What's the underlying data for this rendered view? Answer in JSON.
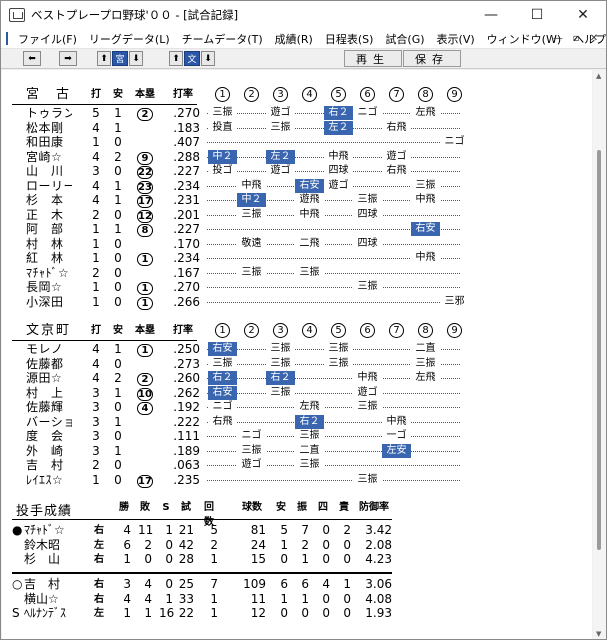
{
  "window": {
    "title": "ベストプレープロ野球'００ - [試合記録]",
    "min": "—",
    "max": "☐",
    "close": "✕"
  },
  "menu": [
    "ファイル(F)",
    "リーグデータ(L)",
    "チームデータ(T)",
    "成績(R)",
    "日程表(S)",
    "試合(G)",
    "表示(V)",
    "ウィンドウ(W)",
    "ヘルプ(H)"
  ],
  "mdi": [
    "—",
    "▫",
    "✕"
  ],
  "toolbar": {
    "left": "⬅",
    "right": "➡",
    "up1": "⬆",
    "team1": "宮",
    "dn1": "⬇",
    "up2": "⬆",
    "team2": "文",
    "dn2": "⬇",
    "play": "再生",
    "save": "保存"
  },
  "headers": {
    "at_bat": "打",
    "hit": "安",
    "hr": "本塁",
    "avg": "打率",
    "innings": [
      "1",
      "2",
      "3",
      "4",
      "5",
      "6",
      "7",
      "8",
      "9"
    ]
  },
  "team1": {
    "name": "宮　古",
    "players": [
      {
        "name": "トゥラング",
        "ab": "5",
        "h": "1",
        "hr": "2",
        "avg": ".270",
        "cells": [
          [
            "三振",
            0
          ],
          [
            "",
            0
          ],
          [
            "遊ゴ",
            0
          ],
          [
            "",
            0
          ],
          [
            "右２",
            1
          ],
          [
            "ニゴ",
            0
          ],
          [
            "",
            0
          ],
          [
            "左飛",
            0
          ],
          [
            "",
            0
          ]
        ]
      },
      {
        "name": "松本剛",
        "ab": "4",
        "h": "1",
        "hr": "",
        "avg": ".183",
        "cells": [
          [
            "投直",
            0
          ],
          [
            "",
            0
          ],
          [
            "三振",
            0
          ],
          [
            "",
            0
          ],
          [
            "左２",
            1
          ],
          [
            "",
            0
          ],
          [
            "右飛",
            0
          ],
          [
            "",
            0
          ],
          [
            "",
            0
          ]
        ]
      },
      {
        "name": "和田康",
        "ab": "1",
        "h": "0",
        "hr": "",
        "avg": ".407",
        "cells": [
          [
            "",
            0
          ],
          [
            "",
            0
          ],
          [
            "",
            0
          ],
          [
            "",
            0
          ],
          [
            "",
            0
          ],
          [
            "",
            0
          ],
          [
            "",
            0
          ],
          [
            "",
            0
          ],
          [
            "ニゴ",
            0
          ]
        ]
      },
      {
        "name": "宮崎☆",
        "ab": "4",
        "h": "2",
        "hr": "9",
        "avg": ".288",
        "cells": [
          [
            "中２",
            1
          ],
          [
            "",
            0
          ],
          [
            "左２",
            1
          ],
          [
            "",
            0
          ],
          [
            "中飛",
            0
          ],
          [
            "",
            0
          ],
          [
            "遊ゴ",
            0
          ],
          [
            "",
            0
          ],
          [
            "",
            0
          ]
        ]
      },
      {
        "name": "山　川",
        "ab": "3",
        "h": "0",
        "hr": "22",
        "avg": ".227",
        "cells": [
          [
            "投ゴ",
            0
          ],
          [
            "",
            0
          ],
          [
            "遊ゴ",
            0
          ],
          [
            "",
            0
          ],
          [
            "四球",
            0
          ],
          [
            "",
            0
          ],
          [
            "右飛",
            0
          ],
          [
            "",
            0
          ],
          [
            "",
            0
          ]
        ]
      },
      {
        "name": "ローリー",
        "ab": "4",
        "h": "1",
        "hr": "23",
        "avg": ".234",
        "cells": [
          [
            "",
            0
          ],
          [
            "中飛",
            0
          ],
          [
            "",
            0
          ],
          [
            "右安",
            1
          ],
          [
            "遊ゴ",
            0
          ],
          [
            "",
            0
          ],
          [
            "",
            0
          ],
          [
            "三振",
            0
          ],
          [
            "",
            0
          ]
        ]
      },
      {
        "name": "杉　本",
        "ab": "4",
        "h": "1",
        "hr": "17",
        "avg": ".231",
        "cells": [
          [
            "",
            0
          ],
          [
            "中２",
            1
          ],
          [
            "",
            0
          ],
          [
            "遊飛",
            0
          ],
          [
            "",
            0
          ],
          [
            "三振",
            0
          ],
          [
            "",
            0
          ],
          [
            "中飛",
            0
          ],
          [
            "",
            0
          ]
        ]
      },
      {
        "name": "正　木",
        "ab": "2",
        "h": "0",
        "hr": "12",
        "avg": ".201",
        "cells": [
          [
            "",
            0
          ],
          [
            "三振",
            0
          ],
          [
            "",
            0
          ],
          [
            "中飛",
            0
          ],
          [
            "",
            0
          ],
          [
            "四球",
            0
          ],
          [
            "",
            0
          ],
          [
            "",
            0
          ],
          [
            "",
            0
          ]
        ]
      },
      {
        "name": "阿　部",
        "ab": "1",
        "h": "1",
        "hr": "8",
        "avg": ".227",
        "cells": [
          [
            "",
            0
          ],
          [
            "",
            0
          ],
          [
            "",
            0
          ],
          [
            "",
            0
          ],
          [
            "",
            0
          ],
          [
            "",
            0
          ],
          [
            "",
            0
          ],
          [
            "右安",
            1
          ],
          [
            "",
            0
          ]
        ]
      },
      {
        "name": "村　林",
        "ab": "1",
        "h": "0",
        "hr": "",
        "avg": ".170",
        "cells": [
          [
            "",
            0
          ],
          [
            "敬遠",
            0
          ],
          [
            "",
            0
          ],
          [
            "二飛",
            0
          ],
          [
            "",
            0
          ],
          [
            "四球",
            0
          ],
          [
            "",
            0
          ],
          [
            "",
            0
          ],
          [
            "",
            0
          ]
        ]
      },
      {
        "name": "紅　林",
        "ab": "1",
        "h": "0",
        "hr": "1",
        "avg": ".234",
        "cells": [
          [
            "",
            0
          ],
          [
            "",
            0
          ],
          [
            "",
            0
          ],
          [
            "",
            0
          ],
          [
            "",
            0
          ],
          [
            "",
            0
          ],
          [
            "",
            0
          ],
          [
            "中飛",
            0
          ],
          [
            "",
            0
          ]
        ]
      },
      {
        "name": "ﾏﾁｬﾄﾞ☆",
        "ab": "2",
        "h": "0",
        "hr": "",
        "avg": ".167",
        "cells": [
          [
            "",
            0
          ],
          [
            "三振",
            0
          ],
          [
            "",
            0
          ],
          [
            "三振",
            0
          ],
          [
            "",
            0
          ],
          [
            "",
            0
          ],
          [
            "",
            0
          ],
          [
            "",
            0
          ],
          [
            "",
            0
          ]
        ]
      },
      {
        "name": "長岡☆",
        "ab": "1",
        "h": "0",
        "hr": "1",
        "avg": ".270",
        "cells": [
          [
            "",
            0
          ],
          [
            "",
            0
          ],
          [
            "",
            0
          ],
          [
            "",
            0
          ],
          [
            "",
            0
          ],
          [
            "三振",
            0
          ],
          [
            "",
            0
          ],
          [
            "",
            0
          ],
          [
            "",
            0
          ]
        ]
      },
      {
        "name": "小深田",
        "ab": "1",
        "h": "0",
        "hr": "1",
        "avg": ".266",
        "cells": [
          [
            "",
            0
          ],
          [
            "",
            0
          ],
          [
            "",
            0
          ],
          [
            "",
            0
          ],
          [
            "",
            0
          ],
          [
            "",
            0
          ],
          [
            "",
            0
          ],
          [
            "",
            0
          ],
          [
            "三邪",
            0
          ]
        ]
      }
    ]
  },
  "team2": {
    "name": "文京町",
    "players": [
      {
        "name": "モレノ",
        "ab": "4",
        "h": "1",
        "hr": "1",
        "avg": ".250",
        "cells": [
          [
            "右安",
            1
          ],
          [
            "",
            0
          ],
          [
            "三振",
            0
          ],
          [
            "",
            0
          ],
          [
            "三振",
            0
          ],
          [
            "",
            0
          ],
          [
            "",
            0
          ],
          [
            "二直",
            0
          ],
          [
            "",
            0
          ]
        ]
      },
      {
        "name": "佐藤都",
        "ab": "4",
        "h": "0",
        "hr": "",
        "avg": ".273",
        "cells": [
          [
            "三振",
            0
          ],
          [
            "",
            0
          ],
          [
            "三振",
            0
          ],
          [
            "",
            0
          ],
          [
            "三振",
            0
          ],
          [
            "",
            0
          ],
          [
            "",
            0
          ],
          [
            "三振",
            0
          ],
          [
            "",
            0
          ]
        ]
      },
      {
        "name": "源田☆",
        "ab": "4",
        "h": "2",
        "hr": "2",
        "avg": ".260",
        "cells": [
          [
            "右２",
            1
          ],
          [
            "",
            0
          ],
          [
            "右２",
            1
          ],
          [
            "",
            0
          ],
          [
            "",
            0
          ],
          [
            "中飛",
            0
          ],
          [
            "",
            0
          ],
          [
            "左飛",
            0
          ],
          [
            "",
            0
          ]
        ]
      },
      {
        "name": "村　上",
        "ab": "3",
        "h": "1",
        "hr": "10",
        "avg": ".262",
        "cells": [
          [
            "右安",
            1
          ],
          [
            "",
            0
          ],
          [
            "三振",
            0
          ],
          [
            "",
            0
          ],
          [
            "",
            0
          ],
          [
            "遊ゴ",
            0
          ],
          [
            "",
            0
          ],
          [
            "",
            0
          ],
          [
            "",
            0
          ]
        ]
      },
      {
        "name": "佐藤輝",
        "ab": "3",
        "h": "0",
        "hr": "4",
        "avg": ".192",
        "cells": [
          [
            "ニゴ",
            0
          ],
          [
            "",
            0
          ],
          [
            "",
            0
          ],
          [
            "左飛",
            0
          ],
          [
            "",
            0
          ],
          [
            "三振",
            0
          ],
          [
            "",
            0
          ],
          [
            "",
            0
          ],
          [
            "",
            0
          ]
        ]
      },
      {
        "name": "バーショ",
        "ab": "3",
        "h": "1",
        "hr": "",
        "avg": ".222",
        "cells": [
          [
            "右飛",
            0
          ],
          [
            "",
            0
          ],
          [
            "",
            0
          ],
          [
            "右２",
            1
          ],
          [
            "",
            0
          ],
          [
            "",
            0
          ],
          [
            "中飛",
            0
          ],
          [
            "",
            0
          ],
          [
            "",
            0
          ]
        ]
      },
      {
        "name": "度　会",
        "ab": "3",
        "h": "0",
        "hr": "",
        "avg": ".111",
        "cells": [
          [
            "",
            0
          ],
          [
            "ニゴ",
            0
          ],
          [
            "",
            0
          ],
          [
            "三振",
            0
          ],
          [
            "",
            0
          ],
          [
            "",
            0
          ],
          [
            "一ゴ",
            0
          ],
          [
            "",
            0
          ],
          [
            "",
            0
          ]
        ]
      },
      {
        "name": "外　崎",
        "ab": "3",
        "h": "1",
        "hr": "",
        "avg": ".189",
        "cells": [
          [
            "",
            0
          ],
          [
            "三振",
            0
          ],
          [
            "",
            0
          ],
          [
            "二直",
            0
          ],
          [
            "",
            0
          ],
          [
            "",
            0
          ],
          [
            "左安",
            1
          ],
          [
            "",
            0
          ],
          [
            "",
            0
          ]
        ]
      },
      {
        "name": "吉　村",
        "ab": "2",
        "h": "0",
        "hr": "",
        "avg": ".063",
        "cells": [
          [
            "",
            0
          ],
          [
            "遊ゴ",
            0
          ],
          [
            "",
            0
          ],
          [
            "三振",
            0
          ],
          [
            "",
            0
          ],
          [
            "",
            0
          ],
          [
            "",
            0
          ],
          [
            "",
            0
          ],
          [
            "",
            0
          ]
        ]
      },
      {
        "name": "ﾚｲｴｽ☆",
        "ab": "1",
        "h": "0",
        "hr": "17",
        "avg": ".235",
        "cells": [
          [
            "",
            0
          ],
          [
            "",
            0
          ],
          [
            "",
            0
          ],
          [
            "",
            0
          ],
          [
            "",
            0
          ],
          [
            "三振",
            0
          ],
          [
            "",
            0
          ],
          [
            "",
            0
          ],
          [
            "",
            0
          ]
        ]
      }
    ]
  },
  "pitching": {
    "title": "投手成績",
    "headers": [
      "勝",
      "敗",
      "S",
      "試",
      "回数",
      "球数",
      "安",
      "振",
      "四",
      "責",
      "防御率"
    ],
    "team1": [
      {
        "mark": "●",
        "name": "ﾏﾁｬﾄﾞ☆",
        "hand": "右",
        "vals": [
          "4",
          "11",
          "1",
          "21",
          "5",
          "81",
          "5",
          "7",
          "0",
          "2",
          "3.42"
        ]
      },
      {
        "mark": "",
        "name": "鈴木昭",
        "hand": "左",
        "vals": [
          "6",
          "2",
          "0",
          "42",
          "2",
          "24",
          "1",
          "2",
          "0",
          "0",
          "2.08"
        ]
      },
      {
        "mark": "",
        "name": "杉　山",
        "hand": "右",
        "vals": [
          "1",
          "0",
          "0",
          "28",
          "1",
          "15",
          "0",
          "1",
          "0",
          "0",
          "4.23"
        ]
      }
    ],
    "team2": [
      {
        "mark": "○",
        "name": "吉　村",
        "hand": "右",
        "vals": [
          "3",
          "4",
          "0",
          "25",
          "7",
          "109",
          "6",
          "6",
          "4",
          "1",
          "3.06"
        ]
      },
      {
        "mark": "",
        "name": "横山☆",
        "hand": "右",
        "vals": [
          "4",
          "4",
          "1",
          "33",
          "1",
          "11",
          "1",
          "1",
          "0",
          "0",
          "4.08"
        ]
      },
      {
        "mark": "S",
        "name": "ﾍﾙﾅﾝﾃﾞｽ",
        "hand": "左",
        "vals": [
          "1",
          "1",
          "16",
          "22",
          "1",
          "12",
          "0",
          "0",
          "0",
          "0",
          "1.93"
        ]
      }
    ]
  }
}
